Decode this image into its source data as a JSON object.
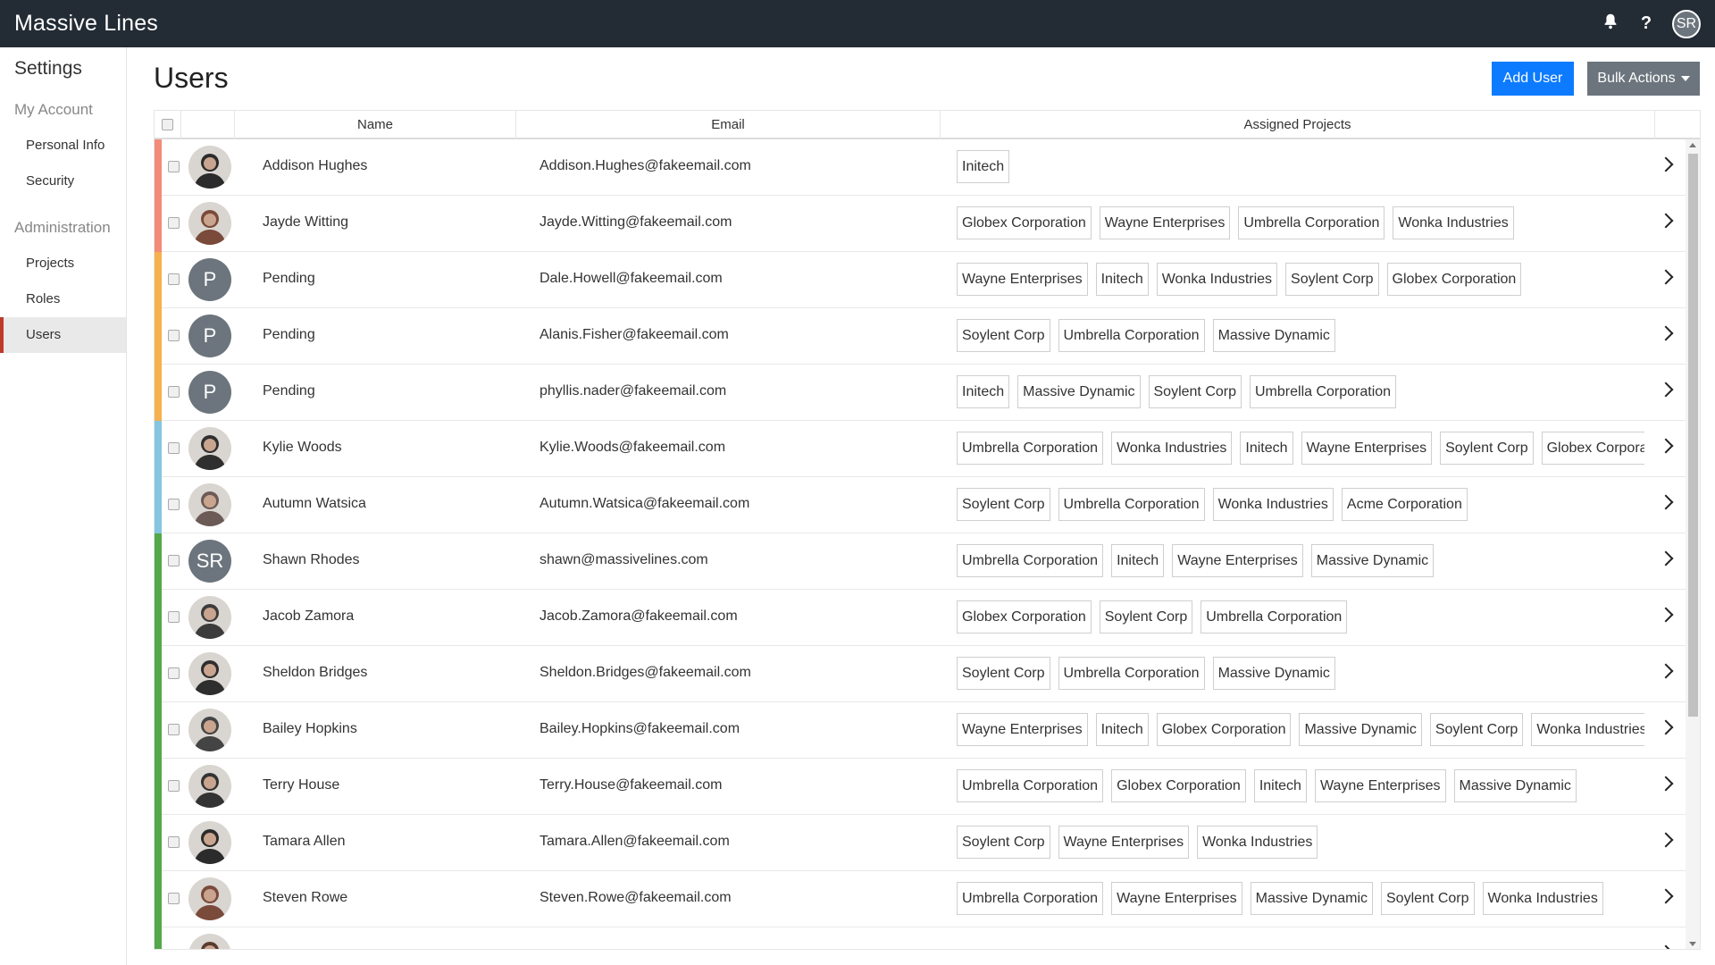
{
  "app": {
    "title": "Massive Lines",
    "user_initials": "SR"
  },
  "icons": {
    "bell": "bell-icon",
    "help": "help-icon"
  },
  "sidebar": {
    "title": "Settings",
    "sections": [
      {
        "label": "My Account",
        "items": [
          "Personal Info",
          "Security"
        ]
      },
      {
        "label": "Administration",
        "items": [
          "Projects",
          "Roles",
          "Users"
        ]
      }
    ],
    "active": "Users"
  },
  "page": {
    "title": "Users",
    "add_user": "Add User",
    "bulk_actions": "Bulk Actions"
  },
  "table": {
    "columns": [
      "Name",
      "Email",
      "Assigned Projects"
    ],
    "rows": [
      {
        "name": "Addison Hughes",
        "email": "Addison.Hughes@fakeemail.com",
        "status_color": "#f28b7a",
        "avatar": "photo",
        "projects": [
          "Initech"
        ]
      },
      {
        "name": "Jayde Witting",
        "email": "Jayde.Witting@fakeemail.com",
        "status_color": "#f28b7a",
        "avatar": "photo",
        "projects": [
          "Globex Corporation",
          "Wayne Enterprises",
          "Umbrella Corporation",
          "Wonka Industries"
        ]
      },
      {
        "name": "Pending",
        "email": "Dale.Howell@fakeemail.com",
        "status_color": "#f5b04f",
        "avatar": "P",
        "projects": [
          "Wayne Enterprises",
          "Initech",
          "Wonka Industries",
          "Soylent Corp",
          "Globex Corporation"
        ]
      },
      {
        "name": "Pending",
        "email": "Alanis.Fisher@fakeemail.com",
        "status_color": "#f5b04f",
        "avatar": "P",
        "projects": [
          "Soylent Corp",
          "Umbrella Corporation",
          "Massive Dynamic"
        ]
      },
      {
        "name": "Pending",
        "email": "phyllis.nader@fakeemail.com",
        "status_color": "#f5b04f",
        "avatar": "P",
        "projects": [
          "Initech",
          "Massive Dynamic",
          "Soylent Corp",
          "Umbrella Corporation"
        ]
      },
      {
        "name": "Kylie Woods",
        "email": "Kylie.Woods@fakeemail.com",
        "status_color": "#86c5e0",
        "avatar": "photo",
        "projects": [
          "Umbrella Corporation",
          "Wonka Industries",
          "Initech",
          "Wayne Enterprises",
          "Soylent Corp",
          "Globex Corporation"
        ]
      },
      {
        "name": "Autumn Watsica",
        "email": "Autumn.Watsica@fakeemail.com",
        "status_color": "#86c5e0",
        "avatar": "photo",
        "projects": [
          "Soylent Corp",
          "Umbrella Corporation",
          "Wonka Industries",
          "Acme Corporation"
        ]
      },
      {
        "name": "Shawn Rhodes",
        "email": "shawn@massivelines.com",
        "status_color": "#52a84a",
        "avatar": "SR",
        "projects": [
          "Umbrella Corporation",
          "Initech",
          "Wayne Enterprises",
          "Massive Dynamic"
        ]
      },
      {
        "name": "Jacob Zamora",
        "email": "Jacob.Zamora@fakeemail.com",
        "status_color": "#52a84a",
        "avatar": "photo",
        "projects": [
          "Globex Corporation",
          "Soylent Corp",
          "Umbrella Corporation"
        ]
      },
      {
        "name": "Sheldon Bridges",
        "email": "Sheldon.Bridges@fakeemail.com",
        "status_color": "#52a84a",
        "avatar": "photo",
        "projects": [
          "Soylent Corp",
          "Umbrella Corporation",
          "Massive Dynamic"
        ]
      },
      {
        "name": "Bailey Hopkins",
        "email": "Bailey.Hopkins@fakeemail.com",
        "status_color": "#52a84a",
        "avatar": "photo",
        "projects": [
          "Wayne Enterprises",
          "Initech",
          "Globex Corporation",
          "Massive Dynamic",
          "Soylent Corp",
          "Wonka Industries"
        ]
      },
      {
        "name": "Terry House",
        "email": "Terry.House@fakeemail.com",
        "status_color": "#52a84a",
        "avatar": "photo",
        "projects": [
          "Umbrella Corporation",
          "Globex Corporation",
          "Initech",
          "Wayne Enterprises",
          "Massive Dynamic"
        ]
      },
      {
        "name": "Tamara Allen",
        "email": "Tamara.Allen@fakeemail.com",
        "status_color": "#52a84a",
        "avatar": "photo",
        "projects": [
          "Soylent Corp",
          "Wayne Enterprises",
          "Wonka Industries"
        ]
      },
      {
        "name": "Steven Rowe",
        "email": "Steven.Rowe@fakeemail.com",
        "status_color": "#52a84a",
        "avatar": "photo",
        "projects": [
          "Umbrella Corporation",
          "Wayne Enterprises",
          "Massive Dynamic",
          "Soylent Corp",
          "Wonka Industries"
        ]
      },
      {
        "name": "",
        "email": "",
        "status_color": "#52a84a",
        "avatar": "photo",
        "projects": []
      }
    ]
  }
}
